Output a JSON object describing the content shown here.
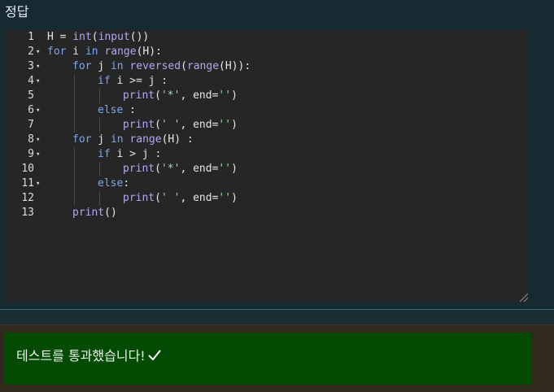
{
  "panel": {
    "title": "정답"
  },
  "editor": {
    "lines": [
      {
        "num": "1",
        "fold": false,
        "indent": 0,
        "tokens": [
          [
            "id",
            "H "
          ],
          [
            "op",
            "="
          ],
          [
            "id",
            " "
          ],
          [
            "bi",
            "int"
          ],
          [
            "id",
            "("
          ],
          [
            "bi",
            "input"
          ],
          [
            "id",
            "())"
          ]
        ]
      },
      {
        "num": "2",
        "fold": true,
        "indent": 0,
        "tokens": [
          [
            "kw",
            "for"
          ],
          [
            "id",
            " i "
          ],
          [
            "kw",
            "in"
          ],
          [
            "id",
            " "
          ],
          [
            "bi",
            "range"
          ],
          [
            "id",
            "(H):"
          ]
        ]
      },
      {
        "num": "3",
        "fold": true,
        "indent": 1,
        "tokens": [
          [
            "kw",
            "for"
          ],
          [
            "id",
            " j "
          ],
          [
            "kw",
            "in"
          ],
          [
            "id",
            " "
          ],
          [
            "bi",
            "reversed"
          ],
          [
            "id",
            "("
          ],
          [
            "bi",
            "range"
          ],
          [
            "id",
            "(H)):"
          ]
        ]
      },
      {
        "num": "4",
        "fold": true,
        "indent": 2,
        "tokens": [
          [
            "kw",
            "if"
          ],
          [
            "id",
            " i "
          ],
          [
            "op",
            ">="
          ],
          [
            "id",
            " j :"
          ]
        ]
      },
      {
        "num": "5",
        "fold": false,
        "indent": 3,
        "tokens": [
          [
            "bi",
            "print"
          ],
          [
            "id",
            "("
          ],
          [
            "st",
            "'*'"
          ],
          [
            "id",
            ", end="
          ],
          [
            "st",
            "''"
          ],
          [
            "id",
            ")"
          ]
        ]
      },
      {
        "num": "6",
        "fold": true,
        "indent": 2,
        "tokens": [
          [
            "kw",
            "else"
          ],
          [
            "id",
            " :"
          ]
        ]
      },
      {
        "num": "7",
        "fold": false,
        "indent": 3,
        "tokens": [
          [
            "bi",
            "print"
          ],
          [
            "id",
            "("
          ],
          [
            "st",
            "' '"
          ],
          [
            "id",
            ", end="
          ],
          [
            "st",
            "''"
          ],
          [
            "id",
            ")"
          ]
        ]
      },
      {
        "num": "8",
        "fold": true,
        "indent": 1,
        "tokens": [
          [
            "kw",
            "for"
          ],
          [
            "id",
            " j "
          ],
          [
            "kw",
            "in"
          ],
          [
            "id",
            " "
          ],
          [
            "bi",
            "range"
          ],
          [
            "id",
            "(H) :"
          ]
        ]
      },
      {
        "num": "9",
        "fold": true,
        "indent": 2,
        "tokens": [
          [
            "kw",
            "if"
          ],
          [
            "id",
            " i "
          ],
          [
            "op",
            ">"
          ],
          [
            "id",
            " j :"
          ]
        ]
      },
      {
        "num": "10",
        "fold": false,
        "indent": 3,
        "tokens": [
          [
            "bi",
            "print"
          ],
          [
            "id",
            "("
          ],
          [
            "st",
            "'*'"
          ],
          [
            "id",
            ", end="
          ],
          [
            "st",
            "''"
          ],
          [
            "id",
            ")"
          ]
        ]
      },
      {
        "num": "11",
        "fold": true,
        "indent": 2,
        "tokens": [
          [
            "kw",
            "else"
          ],
          [
            "id",
            ":"
          ]
        ]
      },
      {
        "num": "12",
        "fold": false,
        "indent": 3,
        "tokens": [
          [
            "bi",
            "print"
          ],
          [
            "id",
            "("
          ],
          [
            "st",
            "' '"
          ],
          [
            "id",
            ", end="
          ],
          [
            "st",
            "''"
          ],
          [
            "id",
            ")"
          ]
        ]
      },
      {
        "num": "13",
        "fold": false,
        "indent": 1,
        "tokens": [
          [
            "bi",
            "print"
          ],
          [
            "id",
            "()"
          ]
        ]
      }
    ]
  },
  "result": {
    "message": "테스트를 통과했습니다!",
    "icon": "check-icon"
  }
}
